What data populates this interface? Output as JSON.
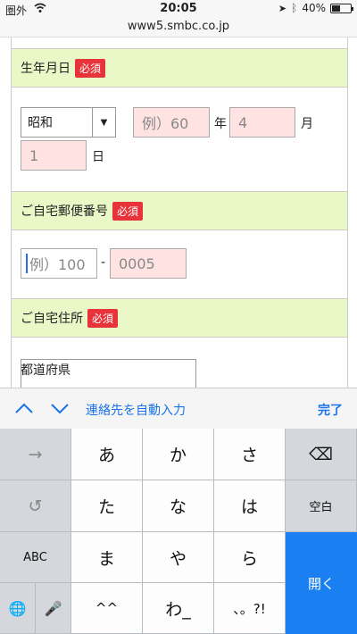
{
  "status_bar": {
    "carrier": "圏外",
    "time": "20:05",
    "battery": "40%",
    "battery_level": 0.4
  },
  "url_bar": {
    "url": "www5.smbc.co.jp"
  },
  "form": {
    "birthdate": {
      "label": "生年月日",
      "required_badge": "必須",
      "era": "昭和",
      "year_placeholder": "例）60",
      "year_unit": "年",
      "month_value": "4",
      "month_unit": "月",
      "day_value": "1",
      "day_unit": "日"
    },
    "postal_code": {
      "label": "ご自宅郵便番号",
      "required_badge": "必須",
      "first_placeholder": "例）100",
      "separator": "-",
      "second_value": "0005"
    },
    "address": {
      "label": "ご自宅住所",
      "required_badge": "必須",
      "prefecture_label": "都道府県"
    }
  },
  "accessory_bar": {
    "autofill": "連絡先を自動入力",
    "done": "完了"
  },
  "keyboard": {
    "row1": [
      "→",
      "あ",
      "か",
      "さ",
      "⌫"
    ],
    "row2": [
      "↺",
      "た",
      "な",
      "は",
      "空白"
    ],
    "row3": [
      "ABC",
      "ま",
      "や",
      "ら"
    ],
    "row4": [
      "🌐",
      "🎤",
      "^^",
      "わ_",
      "、。?!"
    ],
    "open_key": "開く"
  },
  "colors": {
    "section_header_bg": "#eaf7c6",
    "required_badge_bg": "#e8333a",
    "input_required_bg": "#ffe3e3",
    "link_blue": "#1a73e8",
    "open_key_bg": "#1a7ff0"
  }
}
